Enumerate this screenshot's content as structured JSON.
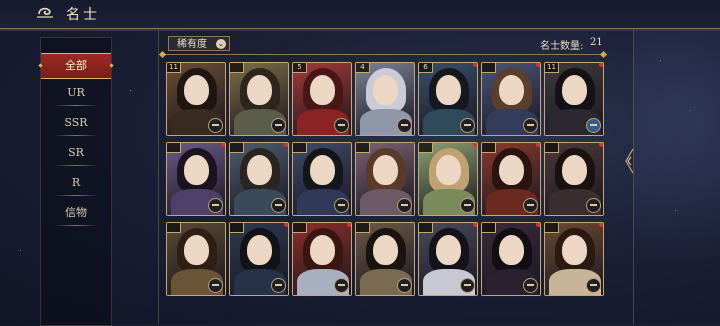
{
  "header": {
    "title": "名士"
  },
  "sidebar": {
    "items": [
      {
        "label": "全部",
        "active": true
      },
      {
        "label": "UR",
        "active": false
      },
      {
        "label": "SSR",
        "active": false
      },
      {
        "label": "SR",
        "active": false
      },
      {
        "label": "R",
        "active": false
      },
      {
        "label": "信物",
        "active": false
      }
    ]
  },
  "toolbar": {
    "filter_label": "稀有度",
    "count_label": "名士数量:",
    "count_value": "21"
  },
  "colors": {
    "accent_red": "#9c2a25",
    "gold": "#c4a870",
    "notice_dot": "#e0302a"
  },
  "cards": [
    {
      "tag": "11",
      "dot": false,
      "badge": "default",
      "palette": [
        "#6b4d35",
        "#1d1612",
        "#3a2b20"
      ]
    },
    {
      "tag": "",
      "dot": false,
      "badge": "default",
      "palette": [
        "#7c6d45",
        "#2d261c",
        "#5b5d4a"
      ]
    },
    {
      "tag": "5",
      "dot": false,
      "badge": "default",
      "palette": [
        "#a23a3a",
        "#4a1716",
        "#8a2424"
      ]
    },
    {
      "tag": "4",
      "dot": false,
      "badge": "default",
      "palette": [
        "#7a8294",
        "#c9ccd6",
        "#8f96a8"
      ]
    },
    {
      "tag": "6",
      "dot": true,
      "badge": "default",
      "palette": [
        "#37506a",
        "#16181f",
        "#2f4a5a"
      ]
    },
    {
      "tag": "",
      "dot": true,
      "badge": "default",
      "palette": [
        "#4a5476",
        "#5a3f2c",
        "#343c5c"
      ]
    },
    {
      "tag": "11",
      "dot": true,
      "badge": "blue",
      "palette": [
        "#3f3a3c",
        "#151216",
        "#2c2830"
      ]
    },
    {
      "tag": "",
      "dot": true,
      "badge": "default",
      "palette": [
        "#6a5a86",
        "#1b1420",
        "#4e4068"
      ]
    },
    {
      "tag": "",
      "dot": true,
      "badge": "default",
      "palette": [
        "#4e5c6e",
        "#2a2520",
        "#3b4a5a"
      ]
    },
    {
      "tag": "",
      "dot": false,
      "badge": "default",
      "palette": [
        "#3f4a6a",
        "#14161c",
        "#303a58"
      ]
    },
    {
      "tag": "",
      "dot": false,
      "badge": "default",
      "palette": [
        "#7a6272",
        "#5a3a2a",
        "#6d5a66"
      ]
    },
    {
      "tag": "",
      "dot": true,
      "badge": "default",
      "palette": [
        "#8aa070",
        "#c0a272",
        "#7a8a5a"
      ]
    },
    {
      "tag": "",
      "dot": true,
      "badge": "default",
      "palette": [
        "#8a3a2a",
        "#2a1410",
        "#6a2a20"
      ]
    },
    {
      "tag": "",
      "dot": true,
      "badge": "default",
      "palette": [
        "#4a3a3a",
        "#1a1210",
        "#3a2e30"
      ]
    },
    {
      "tag": "",
      "dot": false,
      "badge": "default",
      "palette": [
        "#5a4a36",
        "#2e1e14",
        "#6a5438"
      ]
    },
    {
      "tag": "",
      "dot": true,
      "badge": "default",
      "palette": [
        "#2e3a50",
        "#111318",
        "#26324a"
      ]
    },
    {
      "tag": "",
      "dot": true,
      "badge": "default",
      "palette": [
        "#8a2e2a",
        "#3a1610",
        "#a8b0c0"
      ]
    },
    {
      "tag": "",
      "dot": false,
      "badge": "default",
      "palette": [
        "#6a5a46",
        "#1a1410",
        "#7a6a52"
      ]
    },
    {
      "tag": "",
      "dot": true,
      "badge": "default",
      "palette": [
        "#4a4a5a",
        "#14121a",
        "#c8c8d2"
      ]
    },
    {
      "tag": "",
      "dot": true,
      "badge": "default",
      "palette": [
        "#3a2a3a",
        "#120e14",
        "#2a2030"
      ]
    },
    {
      "tag": "",
      "dot": true,
      "badge": "default",
      "palette": [
        "#6a4a30",
        "#2a1a12",
        "#c8b498"
      ]
    }
  ]
}
